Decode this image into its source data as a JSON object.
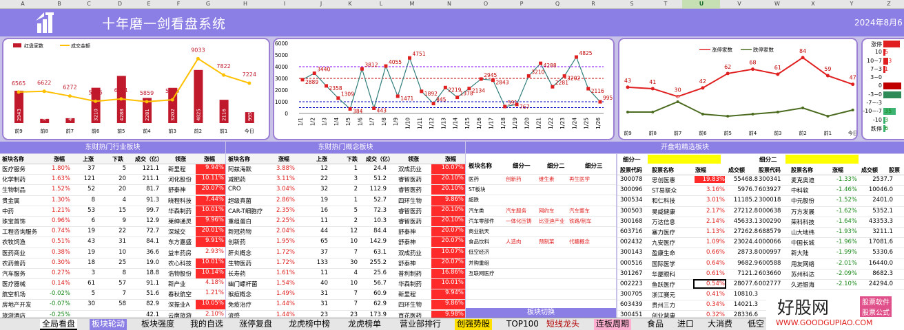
{
  "columns": [
    "A",
    "B",
    "C",
    "D",
    "E",
    "F",
    "G",
    "H",
    "I",
    "J",
    "K",
    "L",
    "M",
    "N",
    "O",
    "P",
    "Q",
    "R",
    "S",
    "T",
    "U",
    "V",
    "W",
    "X",
    "Y",
    "Z"
  ],
  "header": {
    "title": "十年磨一剑看盘系统",
    "date": "2024年8月6"
  },
  "chart1": {
    "legend": [
      "红盘家数",
      "成交金额"
    ],
    "categories": [
      "前9",
      "前8",
      "前7",
      "前6",
      "前5",
      "前4",
      "前3",
      "前2",
      "前1",
      "今日"
    ],
    "bars": [
      2943,
      385,
      443,
      3210,
      4288,
      2281,
      3202,
      4825,
      2116,
      995
    ],
    "line": [
      6565,
      6622,
      6272,
      5886,
      6061,
      5859,
      5995,
      9033,
      7822,
      7224
    ]
  },
  "chart2": {
    "y_ticks": [
      "6000",
      "5000",
      "4000",
      "3000",
      "2000",
      "1000",
      "0"
    ],
    "dates": [
      "1/1",
      "1/2",
      "1/3",
      "1/4",
      "1/5",
      "1/6",
      "1/7",
      "1/8",
      "1/9",
      "1/10",
      "1/11",
      "1/12",
      "1/13",
      "1/14",
      "1/15",
      "1/16",
      "1/17",
      "1/18",
      "1/19",
      "1/20",
      "1/21",
      "1/22",
      "1/23",
      "1/24",
      "1/25",
      "1/26"
    ],
    "values": [
      2889,
      3440,
      2358,
      1309,
      384,
      3812,
      443,
      4055,
      1471,
      4751,
      1892,
      845,
      2219,
      1378,
      2134,
      2945,
      2843,
      591,
      767,
      3210,
      4288,
      2281,
      3202,
      4825,
      2116,
      995
    ],
    "labels": [
      "2889",
      "3440",
      "2358",
      "1309",
      "384",
      "3812",
      "443",
      "4055",
      "1471",
      "4751",
      "1892",
      "845",
      "2219",
      "1378",
      "2134",
      "2945",
      "2843",
      "591",
      "767",
      "3210",
      "4288",
      "2281",
      "3202",
      "4825",
      "2116",
      "995"
    ]
  },
  "chart3": {
    "legend": [
      "涨停家数",
      "跌停家数"
    ],
    "categories": [
      "前9",
      "前8",
      "前7",
      "前6",
      "前5",
      "前4",
      "前3",
      "前2",
      "前1",
      "今日"
    ],
    "up": [
      43,
      41,
      30,
      42,
      62,
      68,
      61,
      84,
      59,
      47
    ],
    "down": [
      3,
      3,
      8,
      2,
      1,
      2,
      3,
      5,
      1,
      4
    ]
  },
  "dist": {
    "labels": [
      "涨停",
      "10",
      "10~7",
      "7~3",
      "3~0",
      "0",
      "-3~0",
      "-7~-3",
      "-10~-7",
      "-10",
      "跌停"
    ],
    "values": [
      "47",
      "5",
      "13",
      "1",
      "",
      "",
      "",
      "",
      "35",
      "3",
      "6"
    ]
  },
  "sec1": {
    "title": "东财热门行业板块",
    "headers": [
      "板块名称",
      "涨幅",
      "上涨",
      "下跌",
      "成交（亿）",
      "领涨",
      "涨幅"
    ],
    "rows": [
      [
        "医疗服务",
        "1.80%",
        "37",
        "5",
        "121.1",
        "新里程",
        "9.94%"
      ],
      [
        "化学制药",
        "1.63%",
        "121",
        "20",
        "211.1",
        "河化股份",
        "10.11%"
      ],
      [
        "生物制品",
        "1.52%",
        "52",
        "20",
        "81.7",
        "舒泰神",
        "20.07%"
      ],
      [
        "贵金属",
        "1.30%",
        "8",
        "4",
        "91.3",
        "晓程科技",
        "7.44%"
      ],
      [
        "中药",
        "1.21%",
        "53",
        "15",
        "99.7",
        "华森制药",
        "10.01%"
      ],
      [
        "珠宝首饰",
        "0.96%",
        "6",
        "9",
        "12.9",
        "莱绅通灵",
        "9.96%"
      ],
      [
        "工程咨询服务",
        "0.74%",
        "19",
        "22",
        "72.7",
        "深城交",
        "20.01%"
      ],
      [
        "农牧饲渔",
        "0.51%",
        "43",
        "31",
        "84.1",
        "东方嘉盛",
        "9.91%"
      ],
      [
        "医药商业",
        "0.38%",
        "19",
        "10",
        "36.6",
        "益丰药房",
        "2.93%"
      ],
      [
        "农药兽药",
        "0.30%",
        "18",
        "25",
        "19.0",
        "农心科技",
        "10.01%"
      ],
      [
        "汽车服务",
        "0.27%",
        "3",
        "8",
        "18.8",
        "浩物股份",
        "10.14%"
      ],
      [
        "医疗器械",
        "0.14%",
        "61",
        "57",
        "91.1",
        "新产业",
        "4.18%"
      ],
      [
        "航空机场",
        "-0.02%",
        "5",
        "7",
        "51.6",
        "春秋航空",
        "1.21%"
      ],
      [
        "房地产开发",
        "-0.07%",
        "30",
        "58",
        "82.9",
        "深振业A",
        "10.05%"
      ],
      [
        "旅游酒店",
        "-0.25%",
        "",
        "",
        "42.1",
        "云南旅游",
        "2.10%"
      ]
    ]
  },
  "sec2": {
    "title": "东财热门概念板块",
    "headers": [
      "板块名称",
      "涨幅",
      "上涨",
      "下跌",
      "成交（亿）",
      "领涨",
      "涨幅"
    ],
    "rows": [
      [
        "阿兹海默",
        "3.88%",
        "12",
        "1",
        "24.4",
        "双成药业",
        "10.07%"
      ],
      [
        "减肥药",
        "3.11%",
        "22",
        "3",
        "51.2",
        "睿智医药",
        "20.10%"
      ],
      [
        "CRO",
        "3.04%",
        "32",
        "2",
        "112.9",
        "睿智医药",
        "20.10%"
      ],
      [
        "超级真菌",
        "2.86%",
        "19",
        "1",
        "52.7",
        "四环生物",
        "9.86%"
      ],
      [
        "CAR-T细胞疗",
        "2.35%",
        "16",
        "5",
        "72.3",
        "睿智医药",
        "20.10%"
      ],
      [
        "重组蛋白",
        "2.25%",
        "11",
        "2",
        "10.3",
        "睿智医药",
        "20.10%"
      ],
      [
        "新冠药物",
        "2.04%",
        "44",
        "12",
        "84.4",
        "舒泰神",
        "20.07%"
      ],
      [
        "创新药",
        "1.95%",
        "65",
        "10",
        "142.9",
        "舒泰神",
        "20.07%"
      ],
      [
        "肝炎概念",
        "1.72%",
        "37",
        "7",
        "63.1",
        "双成药业",
        "10.07%"
      ],
      [
        "生物医药",
        "1.72%",
        "133",
        "30",
        "255.2",
        "舒泰神",
        "20.07%"
      ],
      [
        "长寿药",
        "1.61%",
        "11",
        "4",
        "25.6",
        "普利制药",
        "16.86%"
      ],
      [
        "幽门螺杆菌",
        "1.54%",
        "40",
        "10",
        "56.7",
        "华森制药",
        "10.01%"
      ],
      [
        "猴痘概念",
        "1.49%",
        "31",
        "7",
        "60.9",
        "新里程",
        "9.94%"
      ],
      [
        "免疫治疗",
        "1.44%",
        "31",
        "7",
        "62.9",
        "四环生物",
        "9.86%"
      ],
      [
        "流感",
        "1.44%",
        "23",
        "23",
        "173.9",
        "百花医药",
        "9.98%"
      ]
    ]
  },
  "sec3": {
    "title": "开盘啦精选板块",
    "headers": [
      "板块名称",
      "细分一",
      "细分二",
      "细分三"
    ],
    "rows": [
      [
        "医药",
        "创新药",
        "维生素",
        "再生医学"
      ],
      [
        "ST板块",
        "",
        "",
        ""
      ],
      [
        "超跌",
        "",
        "",
        ""
      ],
      [
        "汽车类",
        "汽车服务",
        "网约车",
        "汽车整车"
      ],
      [
        "汽车零部件",
        "一体化压铸",
        "比亚迪产业",
        "铁路/制车"
      ],
      [
        "商业航天",
        "",
        "",
        ""
      ],
      [
        "食品饮料",
        "人造肉",
        "预制菜",
        "代糖概念"
      ],
      [
        "低空经济",
        "",
        "",
        ""
      ],
      [
        "并购重组",
        "",
        "",
        ""
      ],
      [
        "互联网医疗",
        "",
        "",
        ""
      ],
      [
        "",
        "",
        "",
        ""
      ],
      [
        "",
        "",
        "",
        ""
      ],
      [
        "",
        "",
        "",
        ""
      ],
      [
        "",
        "",
        "",
        ""
      ]
    ],
    "switch": "板块切换"
  },
  "sec4": {
    "group1": "细分一",
    "group2": "细分二",
    "headers": [
      "股票代码",
      "股票名称",
      "涨幅",
      "成交额",
      "股票代码",
      "股票名称",
      "涨幅",
      "成交额",
      "股票"
    ],
    "rows": [
      [
        "300078",
        "思创医惠",
        "19.83%",
        "55468.8",
        "300341",
        "麦克奥迪",
        "-1.33%",
        "2537.7"
      ],
      [
        "300096",
        "ST易联众",
        "3.16%",
        "5976.7",
        "603927",
        "中科软",
        "-1.46%",
        "10046.0"
      ],
      [
        "300534",
        "和仁科技",
        "3.01%",
        "11185.2",
        "300018",
        "中元股份",
        "-1.52%",
        "2401.0"
      ],
      [
        "300503",
        "昊威健康",
        "2.17%",
        "27212.8",
        "000638",
        "万方发展",
        "-1.62%",
        "5352.1"
      ],
      [
        "300168",
        "万达信息",
        "2.14%",
        "45633.1",
        "300290",
        "荣科科技",
        "-1.64%",
        "43353.3"
      ],
      [
        "603716",
        "塞力医疗",
        "1.13%",
        "27262.8",
        "688579",
        "山大地纬",
        "-1.93%",
        "3211.1"
      ],
      [
        "002432",
        "九安医疗",
        "1.09%",
        "23024.4",
        "000066",
        "中国长城",
        "-1.96%",
        "17081.6"
      ],
      [
        "300143",
        "盈康生命",
        "0.66%",
        "2873.8",
        "000997",
        "新大陆",
        "-1.99%",
        "5330.6"
      ],
      [
        "000516",
        "国际医学",
        "0.64%",
        "9682.9",
        "600588",
        "用友网络",
        "-2.01%",
        "16440.0"
      ],
      [
        "301267",
        "华厦眼科",
        "0.61%",
        "7121.2",
        "603660",
        "苏州科达",
        "-2.09%",
        "8682.3"
      ],
      [
        "002223",
        "鱼跃医疗",
        "0.54%",
        "28077.6",
        "002777",
        "久远银海",
        "-2.10%",
        "24294.0"
      ],
      [
        "300705",
        "浙江赛元",
        "0.41%",
        "10810.3",
        "",
        "",
        "",
        ""
      ],
      [
        "603439",
        "贵州三力",
        "0.34%",
        "14021.3",
        "",
        "",
        "",
        ""
      ],
      [
        "300451",
        "创业慧康",
        "0.32%",
        "28336.6",
        "",
        "",
        "",
        ""
      ]
    ]
  },
  "tabs": [
    "全局看盘",
    "板块轮动",
    "板块强度",
    "我的自选",
    "涨停复盘",
    "龙虎榜中榜",
    "龙虎榜单",
    "营业部排行",
    "创强势股",
    "TOP100",
    "短线龙头",
    "连板周期",
    "食品",
    "进口",
    "大消费",
    "低空"
  ],
  "watermark": {
    "text": "好股网",
    "tag1": "股票软件",
    "tag2": "股票公式",
    "url": "WWW.GOODGUPIAO.COM"
  },
  "colors": {
    "accent": "#8b7fe5",
    "bar": "#c0192b",
    "line1": "#ffc000",
    "up": "#e02020",
    "down": "#4a6b1e"
  }
}
